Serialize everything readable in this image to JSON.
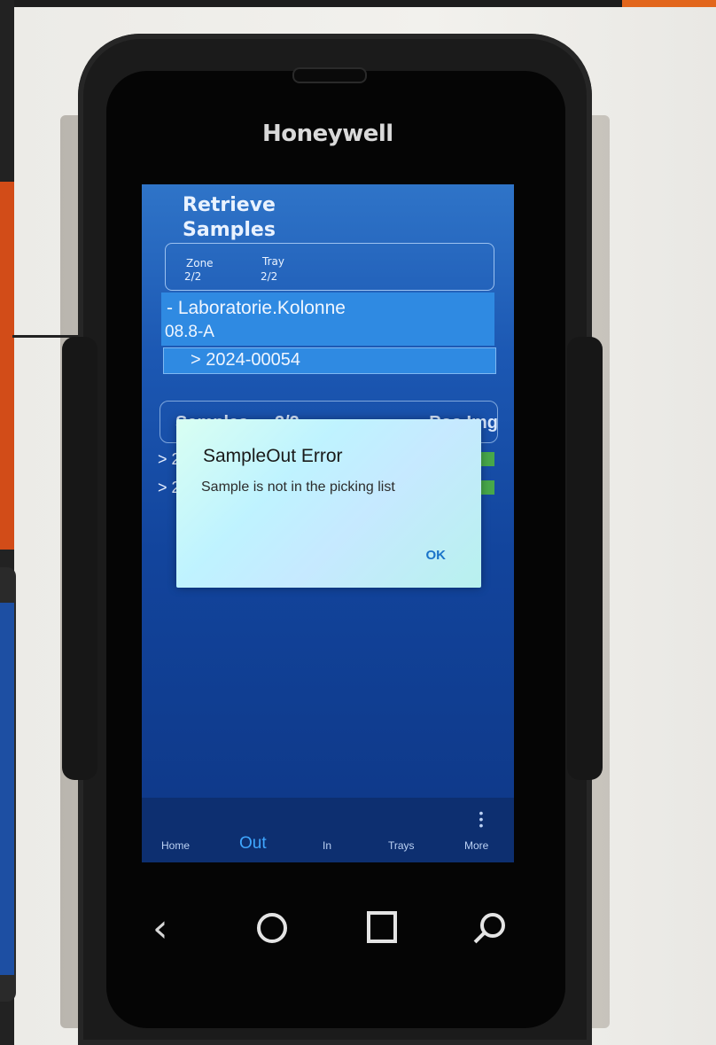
{
  "device": {
    "brand": "Honeywell"
  },
  "app": {
    "title_line1": "Retrieve",
    "title_line2": "Samples",
    "zone_label": "Zone",
    "zone_value": "2/2",
    "tray_label": "Tray",
    "tray_value": "2/2",
    "location_line1": "- Laboratorie.Kolonne",
    "location_line2": "08.8-A",
    "selected_sample": "> 2024-00054",
    "samples_header": "Samples",
    "samples_count": "2/2",
    "samples_right_header": "Pos.Img",
    "rows": [
      "> 2",
      "> 2"
    ]
  },
  "dialog": {
    "title": "SampleOut Error",
    "message": "Sample is not in the picking list",
    "ok_label": "OK"
  },
  "bottom_nav": {
    "items": [
      {
        "label": "Home",
        "active": false
      },
      {
        "label": "Out",
        "active": true
      },
      {
        "label": "In",
        "active": false
      },
      {
        "label": "Trays",
        "active": false
      },
      {
        "label": "More",
        "active": false
      }
    ]
  },
  "colors": {
    "screen_blue": "#1c58b3",
    "active_tab": "#3fa7ff",
    "dialog_ok": "#1a73c9"
  }
}
